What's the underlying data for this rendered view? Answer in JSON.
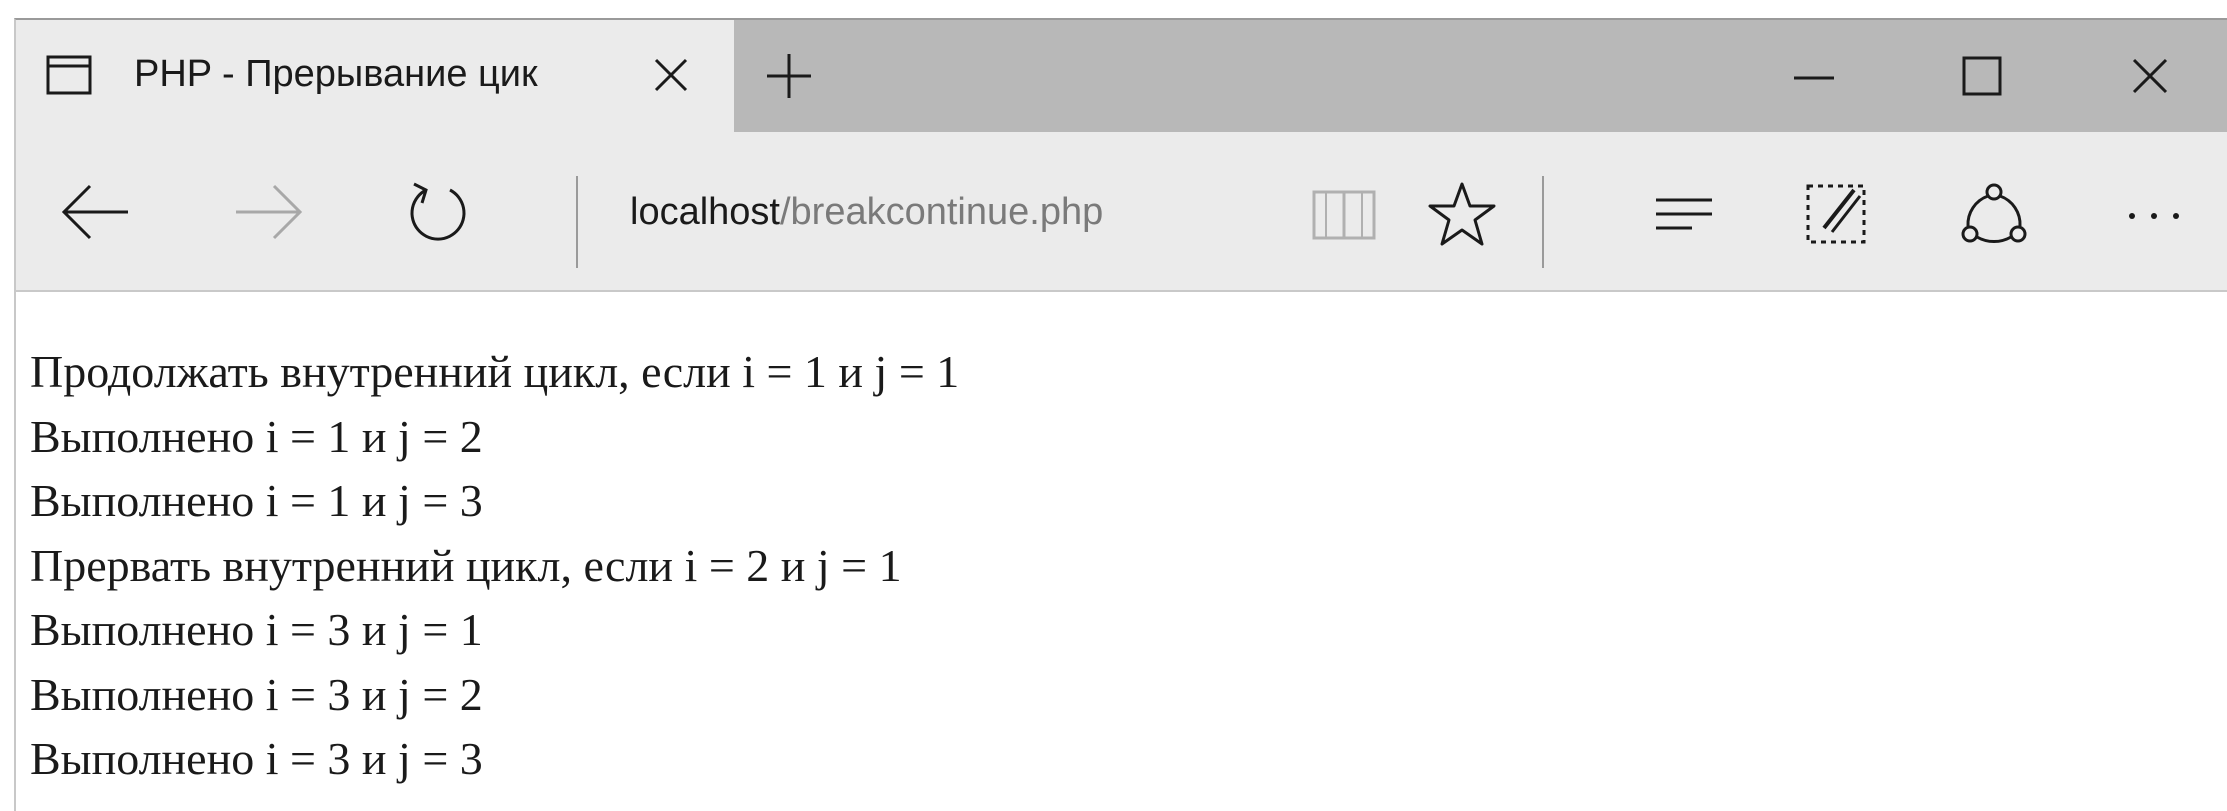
{
  "browser": {
    "tab": {
      "title": "PHP - Прерывание цик",
      "icon": "page-icon"
    },
    "toolbar": {
      "back_icon": "back-arrow-icon",
      "forward_icon": "forward-arrow-icon",
      "refresh_icon": "refresh-icon"
    },
    "address": {
      "host": "localhost",
      "path": "/breakcontinue.php"
    },
    "colors": {
      "tabbar": "#b8b8b8",
      "toolbar": "#ebebeb",
      "host_text": "#1a1a1a",
      "path_text": "#7a7a7a"
    }
  },
  "page": {
    "lines": [
      "Продолжать внутренний цикл, если i = 1 и j = 1",
      "Выполнено i = 1 и j = 2",
      "Выполнено i = 1 и j = 3",
      "Прервать внутренний цикл, если i = 2 и j = 1",
      "Выполнено i = 3 и j = 1",
      "Выполнено i = 3 и j = 2",
      "Выполнено i = 3 и j = 3"
    ]
  }
}
